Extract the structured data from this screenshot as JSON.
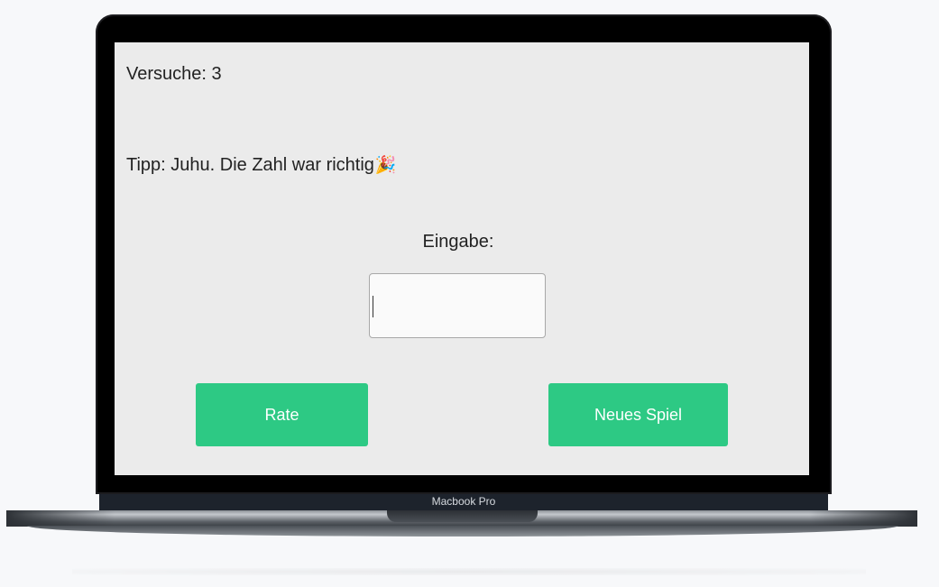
{
  "game": {
    "attempts_text": "Versuche: 3",
    "hint_text": "Tipp: Juhu. Die Zahl war richtig",
    "hint_emoji": "🎉",
    "input_label": "Eingabe:",
    "input_value": "",
    "guess_button_label": "Rate",
    "new_game_button_label": "Neues Spiel"
  },
  "device": {
    "label": "Macbook Pro"
  },
  "colors": {
    "button": "#2dc984",
    "screen_background": "#ebebeb",
    "page_background": "#f7f8fa"
  }
}
